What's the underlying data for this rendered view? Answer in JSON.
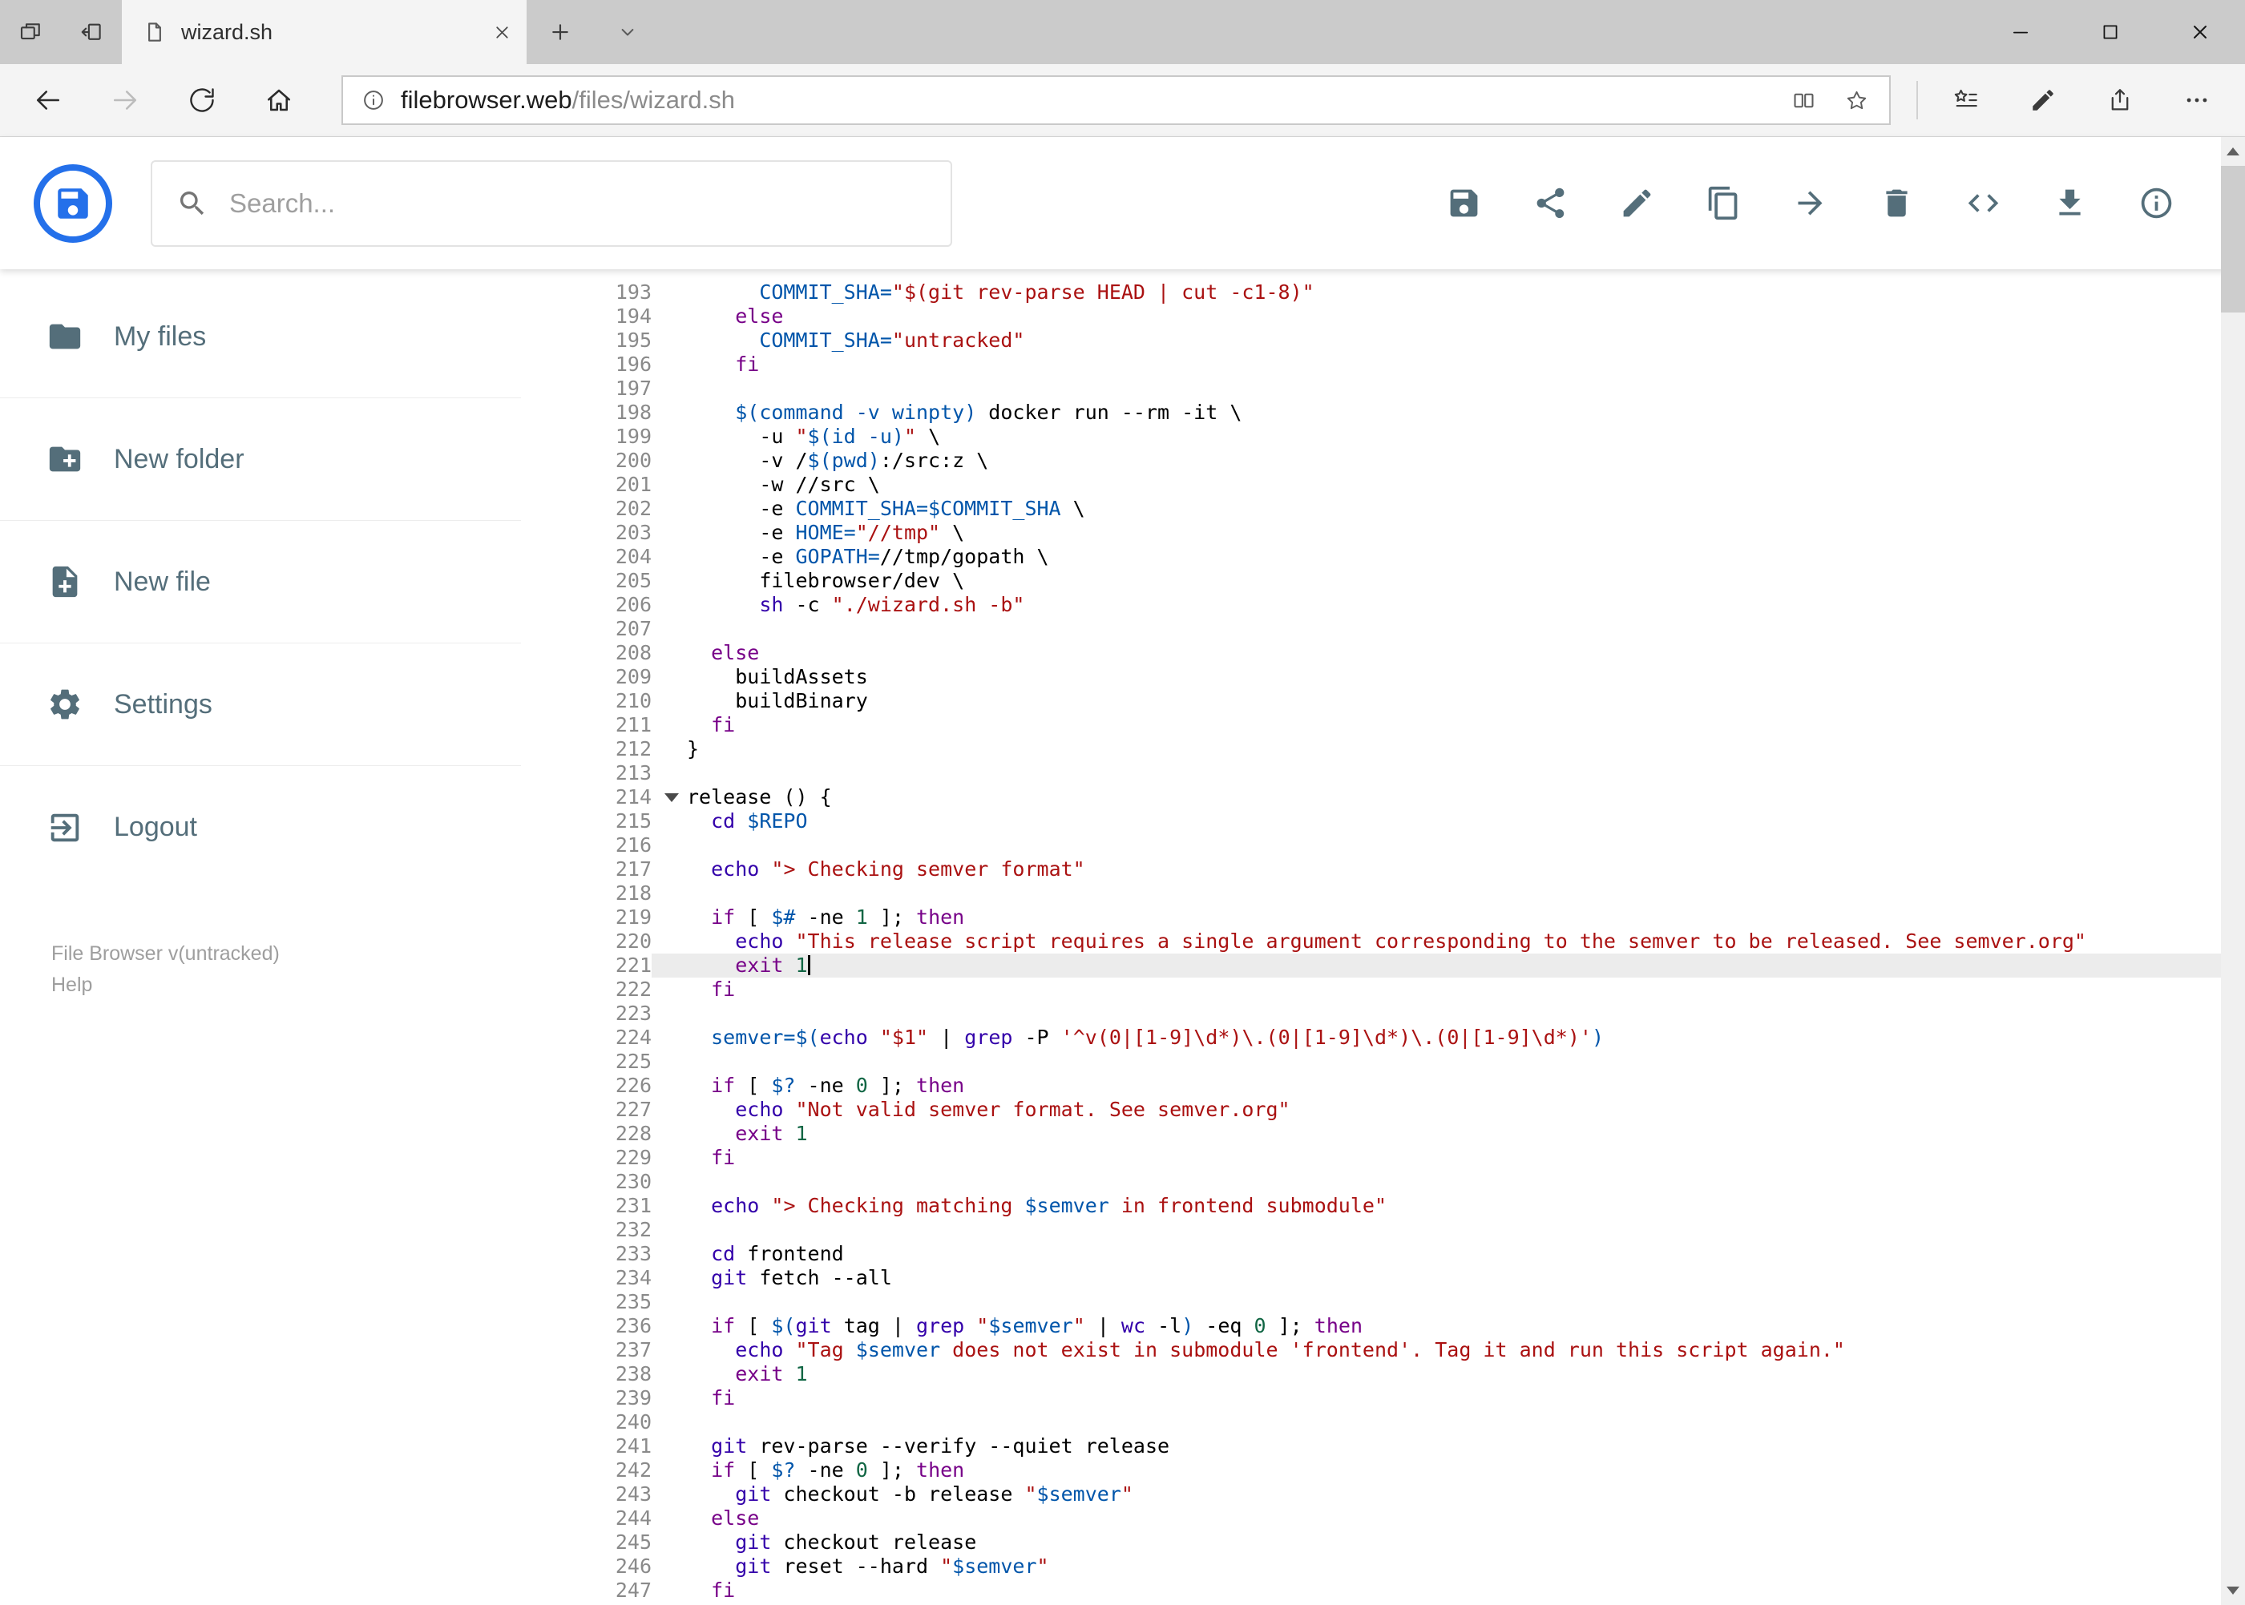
{
  "browser": {
    "tab_title": "wizard.sh",
    "url_domain": "filebrowser.web",
    "url_path": "/files/wizard.sh"
  },
  "header": {
    "search_placeholder": "Search...",
    "toolbar": [
      {
        "name": "save",
        "icon": "save-icon"
      },
      {
        "name": "share",
        "icon": "share-icon"
      },
      {
        "name": "rename",
        "icon": "edit-icon"
      },
      {
        "name": "copy",
        "icon": "copy-icon"
      },
      {
        "name": "move",
        "icon": "move-icon"
      },
      {
        "name": "delete",
        "icon": "delete-icon"
      },
      {
        "name": "raw",
        "icon": "code-icon"
      },
      {
        "name": "download",
        "icon": "download-icon"
      },
      {
        "name": "info",
        "icon": "info-circle-icon"
      }
    ]
  },
  "sidebar": {
    "items": [
      {
        "id": "my-files",
        "label": "My files",
        "icon": "folder-icon"
      },
      {
        "id": "new-folder",
        "label": "New folder",
        "icon": "new-folder-icon"
      },
      {
        "id": "new-file",
        "label": "New file",
        "icon": "new-file-icon"
      },
      {
        "id": "settings",
        "label": "Settings",
        "icon": "settings-icon"
      },
      {
        "id": "logout",
        "label": "Logout",
        "icon": "logout-icon"
      }
    ],
    "footer_version": "File Browser v(untracked)",
    "footer_help": "Help"
  },
  "icons": {
    "search-icon": "magnifier",
    "floppy-logo-icon": "floppy disk in blue ring",
    "back-icon": "left arrow",
    "forward-icon": "right arrow (disabled)",
    "refresh-icon": "circular arrow",
    "home-icon": "house",
    "info-icon": "circled i",
    "reading-view-icon": "book columns",
    "star-icon": "star outline",
    "hub-icon": "star with list lines",
    "web-note-icon": "pen",
    "share-alt-icon": "box with up arrow",
    "more-icon": "ellipsis"
  },
  "colors": {
    "accent_blue": "#2470ea",
    "toolbar_icon": "#546e7a",
    "active_line_bg": "#ececec",
    "keyword": "#770088",
    "builtin": "#3300aa",
    "string": "#aa1111",
    "variable": "#0055aa",
    "number": "#116644"
  },
  "editor": {
    "active_line": 221,
    "fold_line": 214,
    "lines": [
      {
        "n": 193,
        "i": 6,
        "t": [
          [
            "COMMIT_SHA=",
            "v"
          ],
          [
            "\"$(git rev-parse HEAD | cut -c1-8)\"",
            "s"
          ]
        ]
      },
      {
        "n": 194,
        "i": 4,
        "t": [
          [
            "else",
            "k"
          ]
        ]
      },
      {
        "n": 195,
        "i": 6,
        "t": [
          [
            "COMMIT_SHA=",
            "v"
          ],
          [
            "\"untracked\"",
            "s"
          ]
        ]
      },
      {
        "n": 196,
        "i": 4,
        "t": [
          [
            "fi",
            "k"
          ]
        ]
      },
      {
        "n": 197,
        "i": 0,
        "t": []
      },
      {
        "n": 198,
        "i": 4,
        "t": [
          [
            "$(command -v winpty)",
            "v"
          ],
          [
            " docker run --rm -it \\",
            "p"
          ]
        ]
      },
      {
        "n": 199,
        "i": 6,
        "t": [
          [
            "-u ",
            "p"
          ],
          [
            "\"",
            "s"
          ],
          [
            "$(id -u)",
            "v"
          ],
          [
            "\"",
            "s"
          ],
          [
            " \\",
            "p"
          ]
        ]
      },
      {
        "n": 200,
        "i": 6,
        "t": [
          [
            "-v /",
            "p"
          ],
          [
            "$(pwd)",
            "v"
          ],
          [
            ":/src:z \\",
            "p"
          ]
        ]
      },
      {
        "n": 201,
        "i": 6,
        "t": [
          [
            "-w //src \\",
            "p"
          ]
        ]
      },
      {
        "n": 202,
        "i": 6,
        "t": [
          [
            "-e ",
            "p"
          ],
          [
            "COMMIT_SHA=$COMMIT_SHA",
            "v"
          ],
          [
            " \\",
            "p"
          ]
        ]
      },
      {
        "n": 203,
        "i": 6,
        "t": [
          [
            "-e ",
            "p"
          ],
          [
            "HOME=",
            "v"
          ],
          [
            "\"//tmp\"",
            "s"
          ],
          [
            " \\",
            "p"
          ]
        ]
      },
      {
        "n": 204,
        "i": 6,
        "t": [
          [
            "-e ",
            "p"
          ],
          [
            "GOPATH=",
            "v"
          ],
          [
            "//tmp/gopath \\",
            "p"
          ]
        ]
      },
      {
        "n": 205,
        "i": 6,
        "t": [
          [
            "filebrowser/dev \\",
            "p"
          ]
        ]
      },
      {
        "n": 206,
        "i": 6,
        "t": [
          [
            "sh",
            "b"
          ],
          [
            " -c ",
            "p"
          ],
          [
            "\"./wizard.sh -b\"",
            "s"
          ]
        ]
      },
      {
        "n": 207,
        "i": 0,
        "t": []
      },
      {
        "n": 208,
        "i": 2,
        "t": [
          [
            "else",
            "k"
          ]
        ]
      },
      {
        "n": 209,
        "i": 4,
        "t": [
          [
            "buildAssets",
            "p"
          ]
        ]
      },
      {
        "n": 210,
        "i": 4,
        "t": [
          [
            "buildBinary",
            "p"
          ]
        ]
      },
      {
        "n": 211,
        "i": 2,
        "t": [
          [
            "fi",
            "k"
          ]
        ]
      },
      {
        "n": 212,
        "i": 0,
        "t": [
          [
            "}",
            "p"
          ]
        ]
      },
      {
        "n": 213,
        "i": 0,
        "t": []
      },
      {
        "n": 214,
        "i": 0,
        "t": [
          [
            "release () {",
            "p"
          ]
        ]
      },
      {
        "n": 215,
        "i": 2,
        "t": [
          [
            "cd",
            "b"
          ],
          [
            " ",
            "p"
          ],
          [
            "$REPO",
            "v"
          ]
        ]
      },
      {
        "n": 216,
        "i": 0,
        "t": []
      },
      {
        "n": 217,
        "i": 2,
        "t": [
          [
            "echo",
            "b"
          ],
          [
            " ",
            "p"
          ],
          [
            "\"> Checking semver format\"",
            "s"
          ]
        ]
      },
      {
        "n": 218,
        "i": 0,
        "t": []
      },
      {
        "n": 219,
        "i": 2,
        "t": [
          [
            "if",
            "k"
          ],
          [
            " [ ",
            "p"
          ],
          [
            "$#",
            "v"
          ],
          [
            " -ne ",
            "p"
          ],
          [
            "1",
            "n"
          ],
          [
            " ]; ",
            "p"
          ],
          [
            "then",
            "k"
          ]
        ]
      },
      {
        "n": 220,
        "i": 4,
        "t": [
          [
            "echo",
            "b"
          ],
          [
            " ",
            "p"
          ],
          [
            "\"This release script requires a single argument corresponding to the semver to be released. See semver.org\"",
            "s"
          ]
        ]
      },
      {
        "n": 221,
        "i": 4,
        "t": [
          [
            "exit",
            "k"
          ],
          [
            " ",
            "p"
          ],
          [
            "1",
            "n"
          ]
        ]
      },
      {
        "n": 222,
        "i": 2,
        "t": [
          [
            "fi",
            "k"
          ]
        ]
      },
      {
        "n": 223,
        "i": 0,
        "t": []
      },
      {
        "n": 224,
        "i": 2,
        "t": [
          [
            "semver=$(",
            "v"
          ],
          [
            "echo",
            "b"
          ],
          [
            " ",
            "p"
          ],
          [
            "\"$1\"",
            "s"
          ],
          [
            " | ",
            "p"
          ],
          [
            "grep",
            "b"
          ],
          [
            " -P ",
            "p"
          ],
          [
            "'^v(0|[1-9]\\d*)\\.(0|[1-9]\\d*)\\.(0|[1-9]\\d*)'",
            "s"
          ],
          [
            ")",
            "v"
          ]
        ]
      },
      {
        "n": 225,
        "i": 0,
        "t": []
      },
      {
        "n": 226,
        "i": 2,
        "t": [
          [
            "if",
            "k"
          ],
          [
            " [ ",
            "p"
          ],
          [
            "$?",
            "v"
          ],
          [
            " -ne ",
            "p"
          ],
          [
            "0",
            "n"
          ],
          [
            " ]; ",
            "p"
          ],
          [
            "then",
            "k"
          ]
        ]
      },
      {
        "n": 227,
        "i": 4,
        "t": [
          [
            "echo",
            "b"
          ],
          [
            " ",
            "p"
          ],
          [
            "\"Not valid semver format. See semver.org\"",
            "s"
          ]
        ]
      },
      {
        "n": 228,
        "i": 4,
        "t": [
          [
            "exit",
            "k"
          ],
          [
            " ",
            "p"
          ],
          [
            "1",
            "n"
          ]
        ]
      },
      {
        "n": 229,
        "i": 2,
        "t": [
          [
            "fi",
            "k"
          ]
        ]
      },
      {
        "n": 230,
        "i": 0,
        "t": []
      },
      {
        "n": 231,
        "i": 2,
        "t": [
          [
            "echo",
            "b"
          ],
          [
            " ",
            "p"
          ],
          [
            "\"> Checking matching ",
            "s"
          ],
          [
            "$semver",
            "v"
          ],
          [
            " in frontend submodule\"",
            "s"
          ]
        ]
      },
      {
        "n": 232,
        "i": 0,
        "t": []
      },
      {
        "n": 233,
        "i": 2,
        "t": [
          [
            "cd",
            "b"
          ],
          [
            " frontend",
            "p"
          ]
        ]
      },
      {
        "n": 234,
        "i": 2,
        "t": [
          [
            "git",
            "b"
          ],
          [
            " fetch --all",
            "p"
          ]
        ]
      },
      {
        "n": 235,
        "i": 0,
        "t": []
      },
      {
        "n": 236,
        "i": 2,
        "t": [
          [
            "if",
            "k"
          ],
          [
            " [ ",
            "p"
          ],
          [
            "$(",
            "v"
          ],
          [
            "git",
            "b"
          ],
          [
            " tag | ",
            "p"
          ],
          [
            "grep",
            "b"
          ],
          [
            " ",
            "p"
          ],
          [
            "\"",
            "s"
          ],
          [
            "$semver",
            "v"
          ],
          [
            "\"",
            "s"
          ],
          [
            " | ",
            "p"
          ],
          [
            "wc",
            "b"
          ],
          [
            " -l",
            "p"
          ],
          [
            ")",
            "v"
          ],
          [
            " -eq ",
            "p"
          ],
          [
            "0",
            "n"
          ],
          [
            " ]; ",
            "p"
          ],
          [
            "then",
            "k"
          ]
        ]
      },
      {
        "n": 237,
        "i": 4,
        "t": [
          [
            "echo",
            "b"
          ],
          [
            " ",
            "p"
          ],
          [
            "\"Tag ",
            "s"
          ],
          [
            "$semver",
            "v"
          ],
          [
            " does not exist in submodule 'frontend'. Tag it and run this script again.\"",
            "s"
          ]
        ]
      },
      {
        "n": 238,
        "i": 4,
        "t": [
          [
            "exit",
            "k"
          ],
          [
            " ",
            "p"
          ],
          [
            "1",
            "n"
          ]
        ]
      },
      {
        "n": 239,
        "i": 2,
        "t": [
          [
            "fi",
            "k"
          ]
        ]
      },
      {
        "n": 240,
        "i": 0,
        "t": []
      },
      {
        "n": 241,
        "i": 2,
        "t": [
          [
            "git",
            "b"
          ],
          [
            " rev-parse --verify --quiet release",
            "p"
          ]
        ]
      },
      {
        "n": 242,
        "i": 2,
        "t": [
          [
            "if",
            "k"
          ],
          [
            " [ ",
            "p"
          ],
          [
            "$?",
            "v"
          ],
          [
            " -ne ",
            "p"
          ],
          [
            "0",
            "n"
          ],
          [
            " ]; ",
            "p"
          ],
          [
            "then",
            "k"
          ]
        ]
      },
      {
        "n": 243,
        "i": 4,
        "t": [
          [
            "git",
            "b"
          ],
          [
            " checkout -b release ",
            "p"
          ],
          [
            "\"",
            "s"
          ],
          [
            "$semver",
            "v"
          ],
          [
            "\"",
            "s"
          ]
        ]
      },
      {
        "n": 244,
        "i": 2,
        "t": [
          [
            "else",
            "k"
          ]
        ]
      },
      {
        "n": 245,
        "i": 4,
        "t": [
          [
            "git",
            "b"
          ],
          [
            " checkout release",
            "p"
          ]
        ]
      },
      {
        "n": 246,
        "i": 4,
        "t": [
          [
            "git",
            "b"
          ],
          [
            " reset --hard ",
            "p"
          ],
          [
            "\"",
            "s"
          ],
          [
            "$semver",
            "v"
          ],
          [
            "\"",
            "s"
          ]
        ]
      },
      {
        "n": 247,
        "i": 2,
        "t": [
          [
            "fi",
            "k"
          ]
        ]
      }
    ]
  }
}
